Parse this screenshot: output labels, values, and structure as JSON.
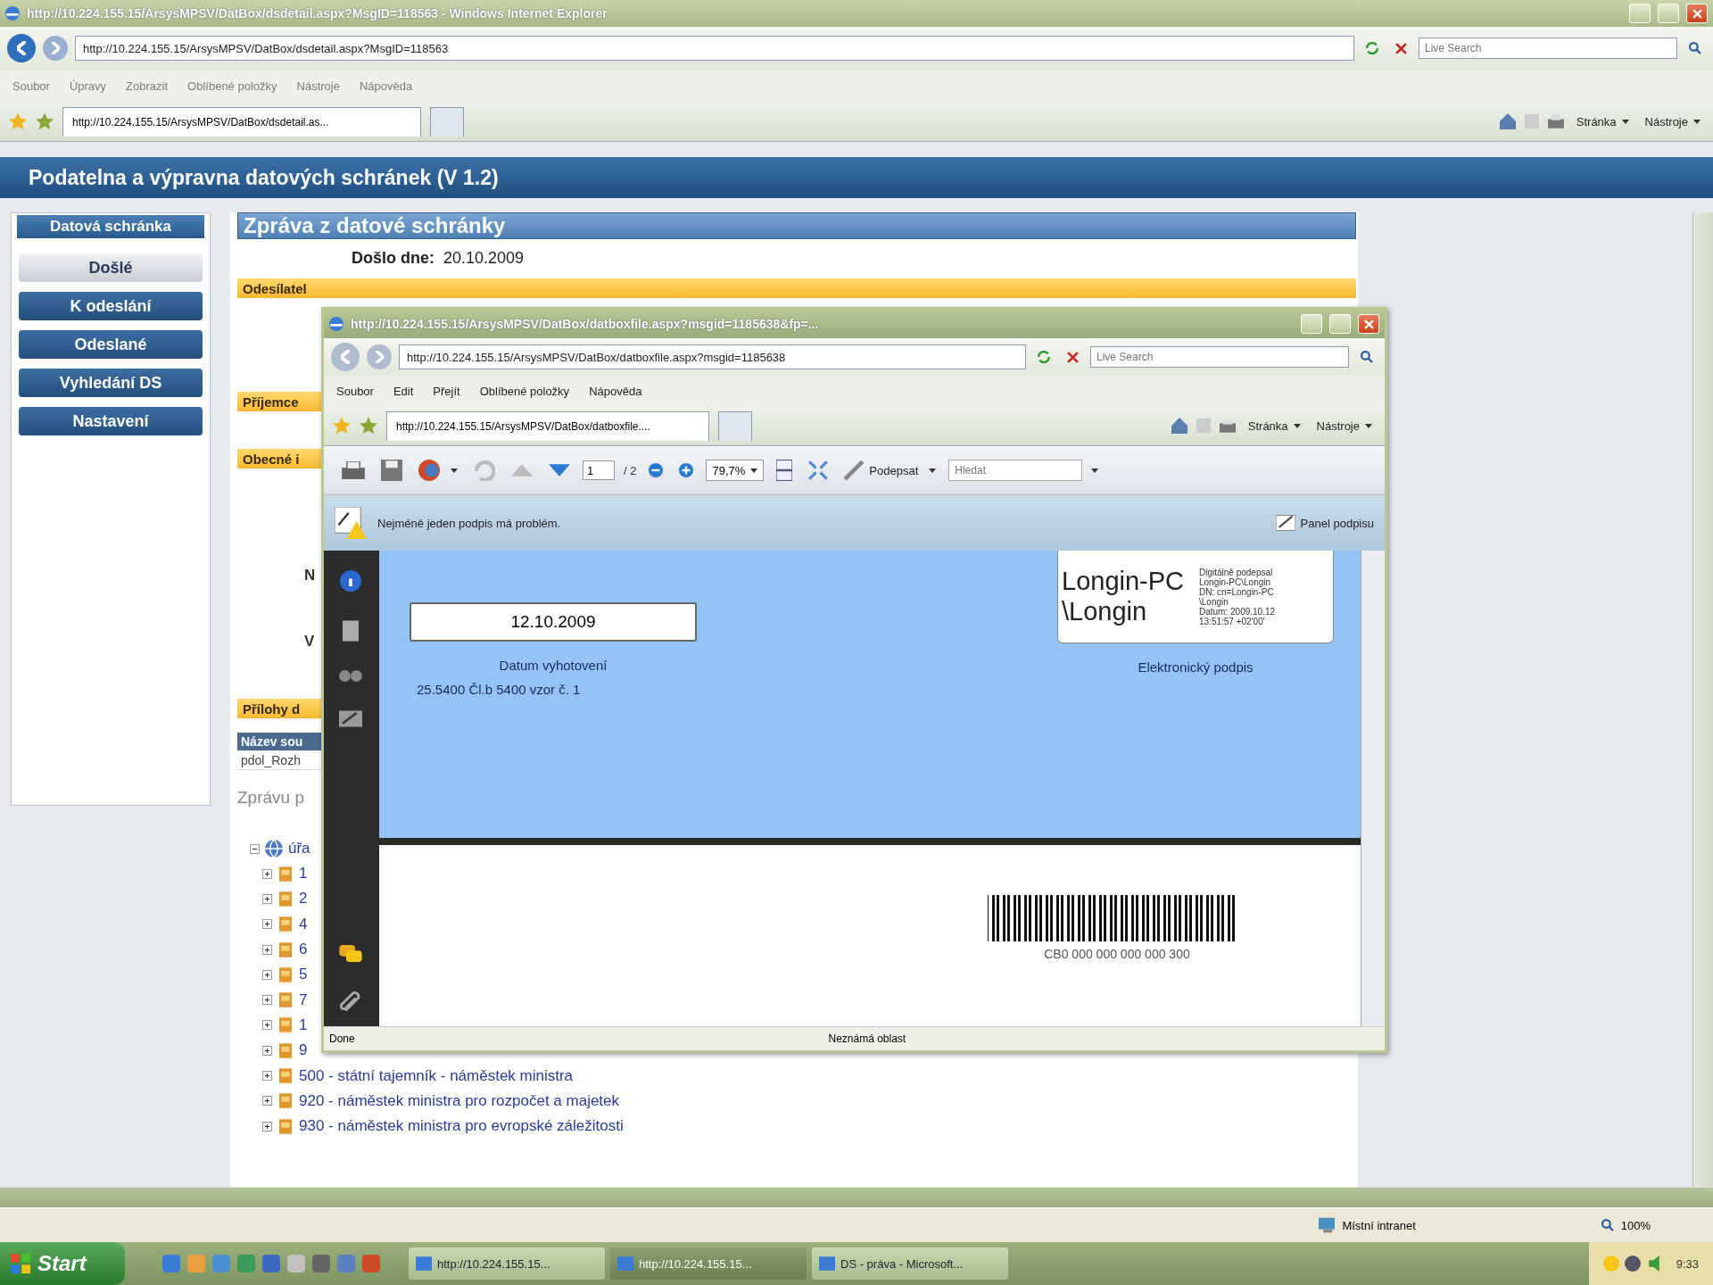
{
  "window": {
    "title": "http://10.224.155.15/ArsysMPSV/DatBox/dsdetail.aspx?MsgID=118563 - Windows Internet Explorer",
    "address": "http://10.224.155.15/ArsysMPSV/DatBox/dsdetail.aspx?MsgID=118563",
    "search_placeholder": "Live Search",
    "menu": [
      "Soubor",
      "Úpravy",
      "Zobrazit",
      "Oblíbené položky",
      "Nástroje",
      "Nápověda"
    ],
    "tab": "http://10.224.155.15/ArsysMPSV/DatBox/dsdetail.as...",
    "commands": [
      "Stránka",
      "Nástroje"
    ]
  },
  "app": {
    "title": "Podatelna a výpravna datových schránek (V 1.2)",
    "sidebar": {
      "title": "Datová schránka",
      "items": [
        {
          "label": "Došlé",
          "selected": true
        },
        {
          "label": "K odeslání",
          "selected": false
        },
        {
          "label": "Odeslané",
          "selected": false
        },
        {
          "label": "Vyhledání DS",
          "selected": false
        },
        {
          "label": "Nastavení",
          "selected": false
        }
      ]
    },
    "message": {
      "heading": "Zpráva z datové schránky",
      "received_label": "Došlo dne:",
      "received_date": "20.10.2009",
      "sections": [
        "Odesílatel",
        "Příjemce",
        "Obecné i"
      ],
      "field_labels": [
        "N",
        "V"
      ],
      "attachments": {
        "title": "Přílohy d",
        "column": "Název sou",
        "rows": [
          "pdol_Rozh"
        ]
      },
      "forward_label": "Zprávu p",
      "tree": {
        "label": "úřa",
        "expanded": true,
        "children": [
          {
            "label": "1",
            "expanded": false
          },
          {
            "label": "2",
            "expanded": false
          },
          {
            "label": "4",
            "expanded": false
          },
          {
            "label": "6",
            "expanded": false
          },
          {
            "label": "5",
            "expanded": false
          },
          {
            "label": "7",
            "expanded": false
          },
          {
            "label": "1",
            "expanded": false
          },
          {
            "label": "9",
            "expanded": false
          },
          {
            "label": "500 - státní tajemník - náměstek ministra",
            "expanded": false
          },
          {
            "label": "920 - náměstek ministra pro rozpočet a majetek",
            "expanded": false
          },
          {
            "label": "930 - náměstek ministra pro evropské záležitosti",
            "expanded": false
          }
        ]
      }
    }
  },
  "status_bar": {
    "zone": "Místní intranet",
    "zoom": "100%"
  },
  "popup": {
    "title": "http://10.224.155.15/ArsysMPSV/DatBox/datboxfile.aspx?msgid=1185638&fp=...",
    "address": "http://10.224.155.15/ArsysMPSV/DatBox/datboxfile.aspx?msgid=1185638",
    "search_placeholder": "Live Search",
    "menu": [
      "Soubor",
      "Edit",
      "Přejít",
      "Oblíbené položky",
      "Nápověda"
    ],
    "tab": "http://10.224.155.15/ArsysMPSV/DatBox/datboxfile....",
    "commands": [
      "Stránka",
      "Nástroje"
    ],
    "pdf": {
      "page": "1",
      "pages": "/ 2",
      "zoom": "79,7%",
      "sign": "Podepsat",
      "find_placeholder": "Hledat",
      "notice": "Nejméně jeden podpis má problém.",
      "signature_panel": "Panel podpisu",
      "date": "12.10.2009",
      "date_label": "Datum vyhotovení",
      "form_code": "25.5400 Čl.b 5400 vzor č. 1",
      "signature_name": "Longin-PC \\Longin",
      "signature_details": [
        "Digitálně podepsal",
        "Longin-PC\\Longin",
        "DN: cn=Longin-PC",
        "\\Longin",
        "Datum: 2009.10.12",
        "13:51:57 +02'00'"
      ],
      "signature_label": "Elektronický podpis",
      "barcode_text": "CB0 000 000 000 000 300"
    },
    "status": "Done",
    "zone": "Neznámá oblast"
  },
  "taskbar": {
    "start": "Start",
    "tasks": [
      {
        "label": "http://10.224.155.15...",
        "selected": false
      },
      {
        "label": "http://10.224.155.15...",
        "selected": true
      },
      {
        "label": "DS - práva - Microsoft...",
        "selected": false
      }
    ],
    "clock": "9:33"
  }
}
